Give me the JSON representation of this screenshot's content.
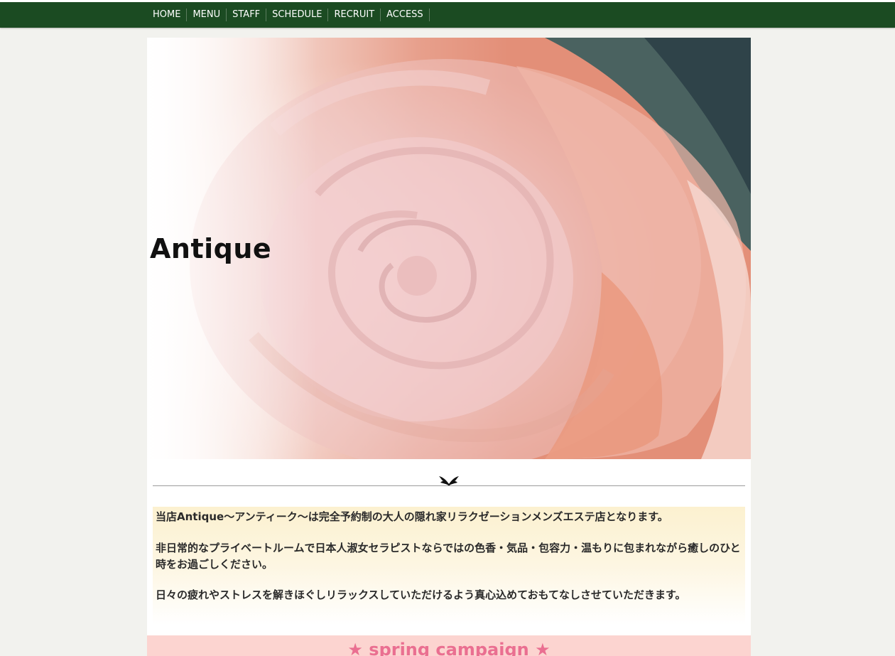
{
  "nav": {
    "items": [
      "HOME",
      "MENU",
      "STAFF",
      "SCHEDULE",
      "RECRUIT",
      "ACCESS"
    ]
  },
  "hero": {
    "title": "Antique"
  },
  "divider": {
    "icon": "wings-icon"
  },
  "intro": {
    "paragraphs": [
      "当店Antique～アンティーク～は完全予約制の大人の隠れ家リラクゼーションメンズエステ店となります。",
      "非日常的なプライベートルームで日本人淑女セラピストならではの色香・気品・包容力・温もりに包まれながら癒しのひと時をお過ごしください。",
      "日々の疲れやストレスを解きほぐしリラックスしていただけるよう真心込めておもてなしさせていただきます。"
    ]
  },
  "campaign": {
    "title": "★ spring campaign ★"
  },
  "colors": {
    "nav_bg": "#1b4b22",
    "page_bg": "#f2f2ee",
    "campaign_bg": "#fcd4d0",
    "campaign_text": "#ea6f91",
    "intro_bg": "#fcf1d0"
  }
}
